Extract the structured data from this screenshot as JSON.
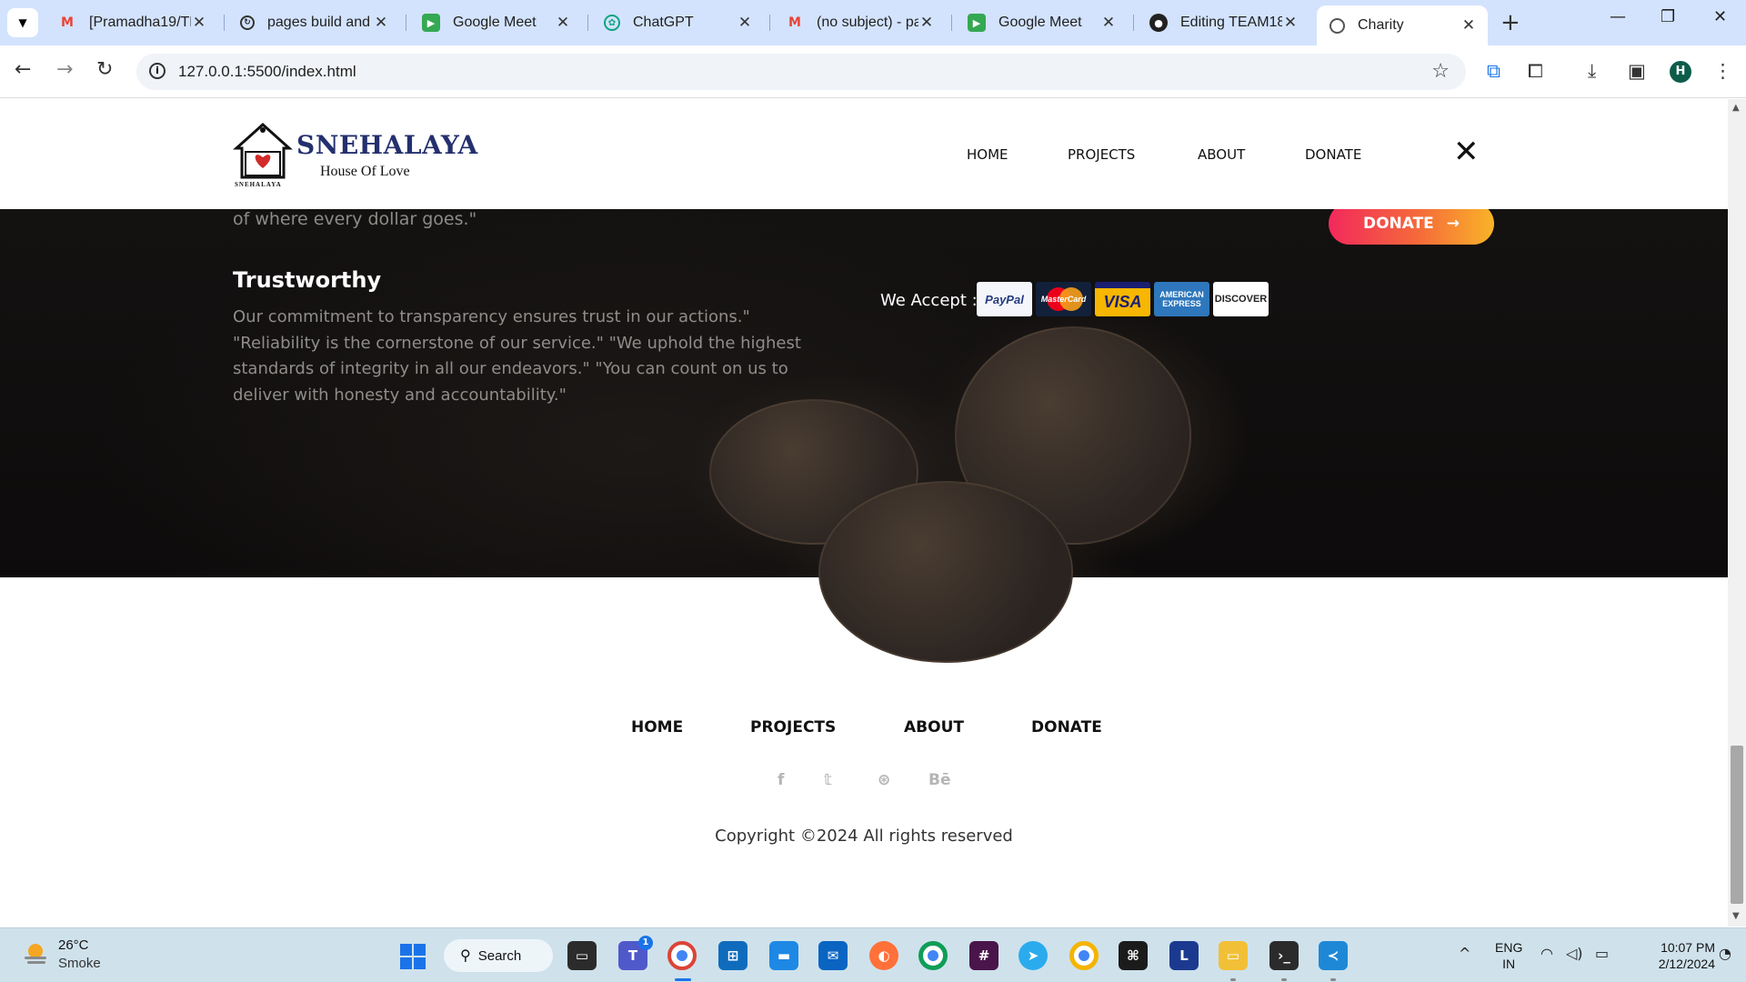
{
  "browser": {
    "tabs": [
      {
        "label": "[Pramadha19/TE",
        "icon": "gmail-icon"
      },
      {
        "label": "pages build and",
        "icon": "github-actions-icon"
      },
      {
        "label": "Google Meet",
        "icon": "google-meet-icon"
      },
      {
        "label": "ChatGPT",
        "icon": "chatgpt-icon"
      },
      {
        "label": "(no subject) - pa",
        "icon": "gmail-icon"
      },
      {
        "label": "Google Meet",
        "icon": "google-meet-icon"
      },
      {
        "label": "Editing TEAM18",
        "icon": "github-icon"
      },
      {
        "label": "Charity",
        "icon": "globe-icon",
        "active": true
      }
    ],
    "url": "127.0.0.1:5500/index.html",
    "profile_initial": "H"
  },
  "site": {
    "logo": {
      "name": "SNEHALAYA",
      "tagline": "House Of Love",
      "small_text": "SNEHALAYA"
    },
    "nav": [
      "HOME",
      "PROJECTS",
      "ABOUT",
      "DONATE"
    ],
    "close_symbol": "✕"
  },
  "content": {
    "faded_text": "of where every dollar goes.\"",
    "trust_title": "Trustworthy",
    "trust_body": "Our commitment to transparency ensures trust in our actions.\" \"Reliability is the cornerstone of our service.\" \"We uphold the highest standards of integrity in all our endeavors.\" \"You can count on us to deliver with honesty and accountability.\"",
    "accept_label": "We Accept :",
    "cards": [
      "PayPal",
      "MasterCard",
      "VISA",
      "AMERICAN EXPRESS",
      "DISCOVER"
    ],
    "donate_button": "DONATE",
    "donate_arrow": "→"
  },
  "footer": {
    "nav": [
      "HOME",
      "PROJECTS",
      "ABOUT",
      "DONATE"
    ],
    "social": [
      "f",
      "𝕥",
      "⊛",
      "Bē"
    ],
    "social_icons": [
      "facebook-icon",
      "twitter-icon",
      "dribbble-icon",
      "behance-icon"
    ],
    "copyright": "Copyright ©2024 All rights reserved"
  },
  "taskbar": {
    "weather_temp": "26°C",
    "weather_cond": "Smoke",
    "search_label": "Search",
    "teams_badge": "1",
    "lang_line1": "ENG",
    "lang_line2": "IN",
    "time": "10:07 PM",
    "date": "2/12/2024"
  },
  "colors": {
    "tabstrip": "#d3e3fd",
    "donate_gradient_start": "#f2295b",
    "donate_gradient_end": "#f9b428",
    "logo_blue": "#24306e",
    "taskbar": "#cfe2ec"
  }
}
